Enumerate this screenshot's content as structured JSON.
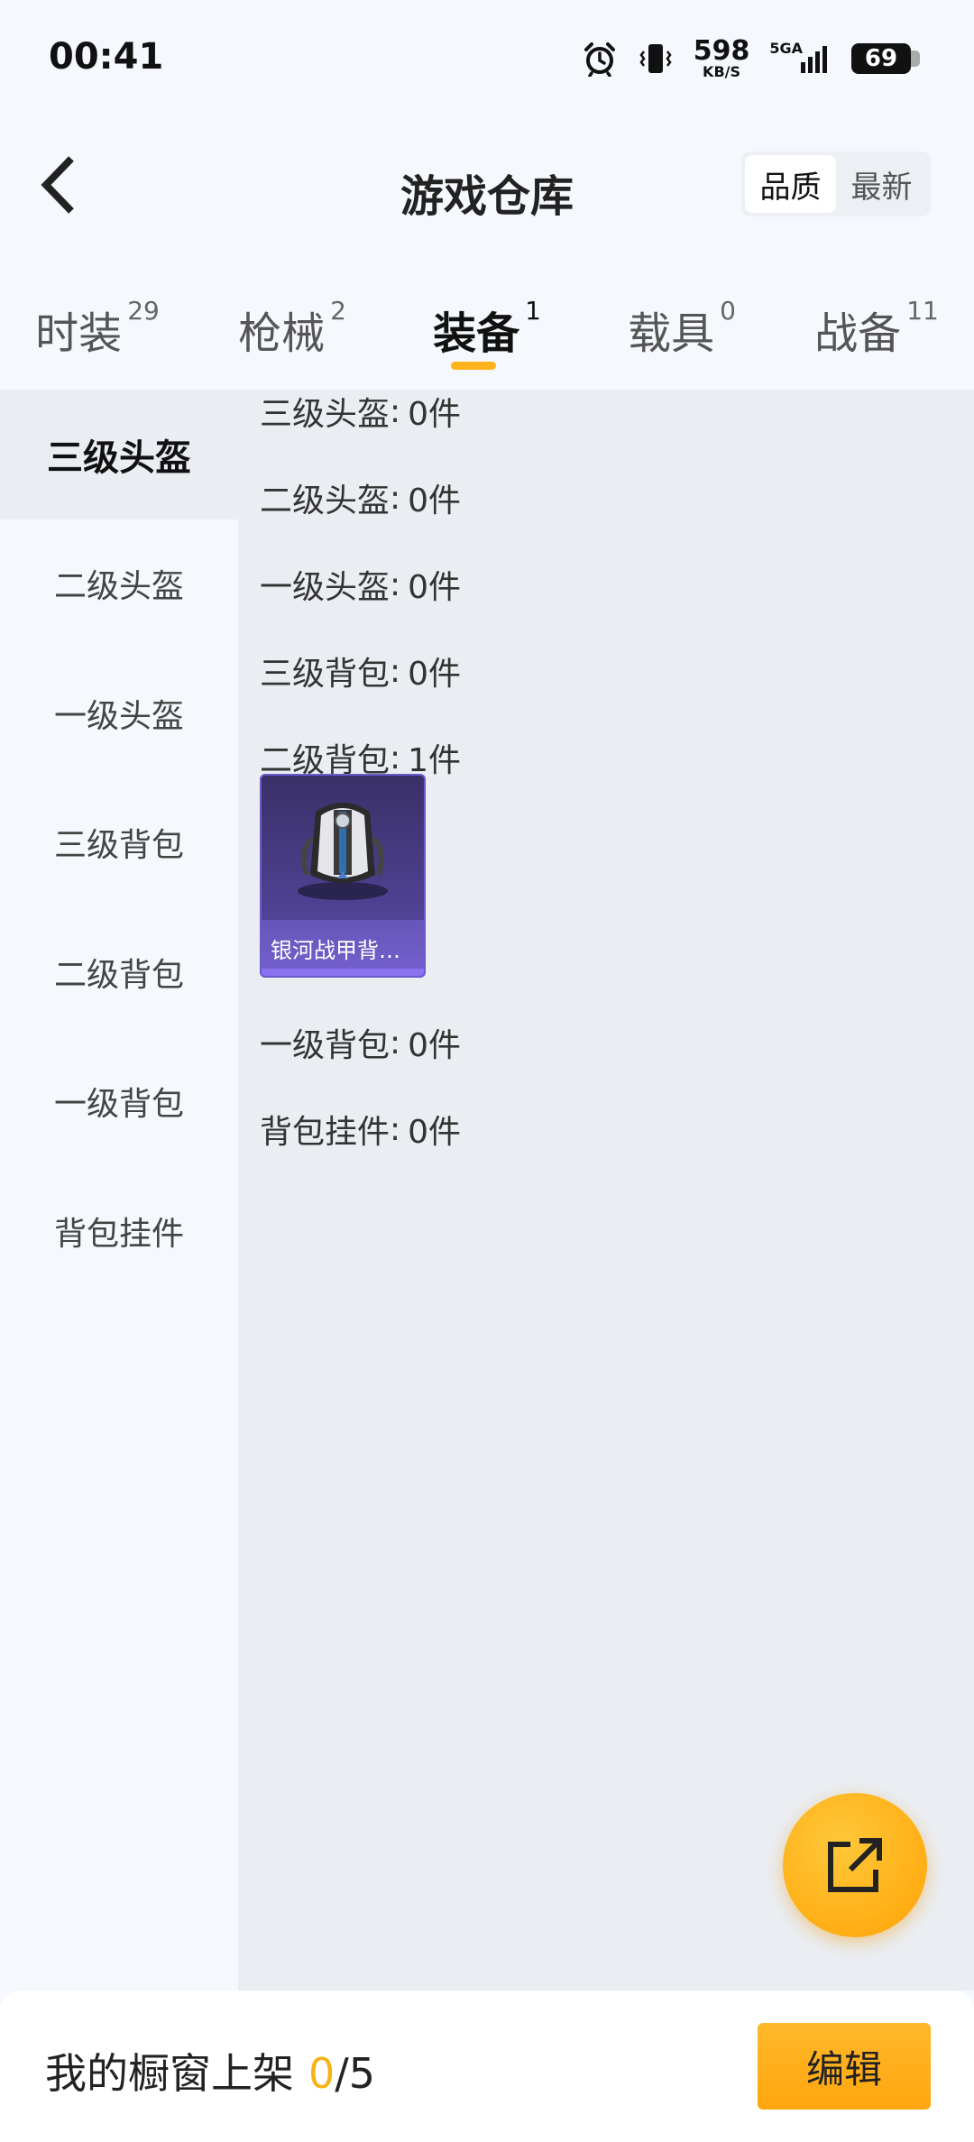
{
  "status_bar": {
    "time": "00:41",
    "net_speed_value": "598",
    "net_speed_unit": "KB/S",
    "net_type": "5GA",
    "battery": "69"
  },
  "header": {
    "title": "游戏仓库",
    "sort_options": [
      "品质",
      "最新"
    ],
    "sort_active": "品质"
  },
  "tabs": [
    {
      "label": "时装",
      "count": "29",
      "active": false
    },
    {
      "label": "枪械",
      "count": "2",
      "active": false
    },
    {
      "label": "装备",
      "count": "1",
      "active": true
    },
    {
      "label": "载具",
      "count": "0",
      "active": false
    },
    {
      "label": "战备",
      "count": "11",
      "active": false
    }
  ],
  "sidebar": {
    "items": [
      {
        "label": "三级头盔",
        "active": true
      },
      {
        "label": "二级头盔",
        "active": false
      },
      {
        "label": "一级头盔",
        "active": false
      },
      {
        "label": "三级背包",
        "active": false
      },
      {
        "label": "二级背包",
        "active": false
      },
      {
        "label": "一级背包",
        "active": false
      },
      {
        "label": "背包挂件",
        "active": false
      }
    ]
  },
  "content": {
    "groups": [
      {
        "name": "三级头盔",
        "count_text": "0件",
        "items": []
      },
      {
        "name": "二级头盔",
        "count_text": "0件",
        "items": []
      },
      {
        "name": "一级头盔",
        "count_text": "0件",
        "items": []
      },
      {
        "name": "三级背包",
        "count_text": "0件",
        "items": []
      },
      {
        "name": "二级背包",
        "count_text": "1件",
        "items": [
          {
            "name": "银河战甲背包...",
            "icon": "backpack-icon"
          }
        ]
      },
      {
        "name": "一级背包",
        "count_text": "0件",
        "items": []
      },
      {
        "name": "背包挂件",
        "count_text": "0件",
        "items": []
      }
    ]
  },
  "bottom_bar": {
    "shelf_label": "我的橱窗上架",
    "shelf_count": "0",
    "shelf_total": "/5",
    "edit_label": "编辑"
  },
  "colors": {
    "accent": "#ffb21a",
    "content_bg": "#eaedf2",
    "page_bg": "#f5f8fc",
    "item_card_bg": "#4a3d8a"
  }
}
